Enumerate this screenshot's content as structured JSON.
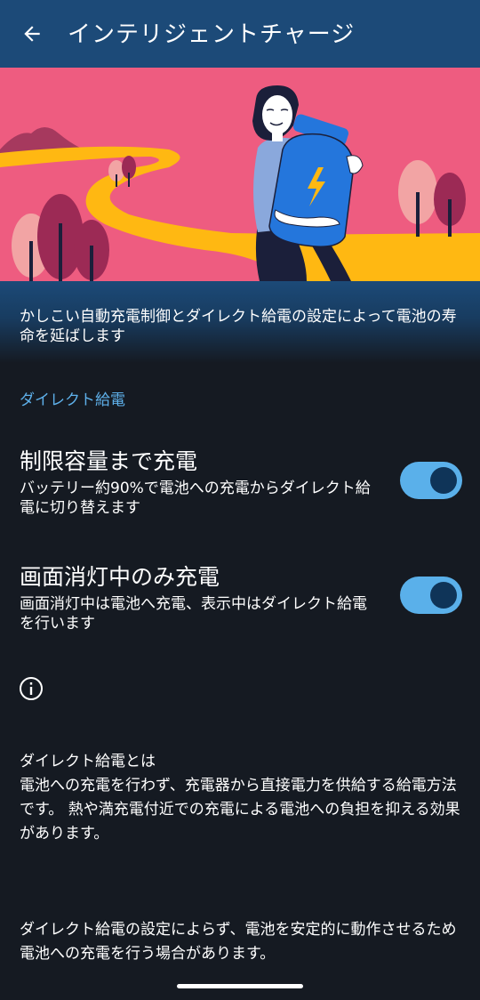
{
  "appbar": {
    "title": "インテリジェントチャージ",
    "back_icon": "arrow-left-icon"
  },
  "hero": {
    "description": "かしこい自動充電制御とダイレクト給電の設定によって電池の寿命を延ばします",
    "colors": {
      "sky": "#ee5c80",
      "path": "#ffb812",
      "battery": "#2476dc",
      "tree_dark": "#9c2a55",
      "tree_light": "#f2a4a4"
    }
  },
  "section": {
    "label": "ダイレクト給電"
  },
  "settings": [
    {
      "title": "制限容量まで充電",
      "subtitle": "バッテリー約90%で電池への充電からダイレクト給電に切り替えます",
      "enabled": true
    },
    {
      "title": "画面消灯中のみ充電",
      "subtitle": "画面消灯中は電池へ充電、表示中はダイレクト給電を行います",
      "enabled": true
    }
  ],
  "info": {
    "icon": "info-icon",
    "paragraph1": "ダイレクト給電とは\n電池への充電を行わず、充電器から直接電力を供給する給電方法です。 熱や満充電付近での充電による電池への負担を抑える効果があります。",
    "paragraph2": "ダイレクト給電の設定によらず、電池を安定的に動作させるため電池への充電を行う場合があります。"
  },
  "colors": {
    "background": "#151a22",
    "appbar": "#1c4a78",
    "accent": "#5eb0ea",
    "toggle_track": "#5ab0ea",
    "toggle_knob": "#0f3458"
  }
}
